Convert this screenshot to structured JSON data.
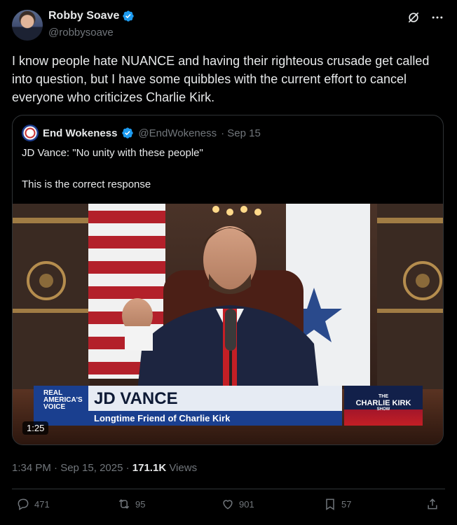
{
  "author": {
    "name": "Robby Soave",
    "handle": "@robbysoave"
  },
  "tweet": {
    "text": "I know people hate NUANCE and having their righteous crusade get called into question, but I have some quibbles with the current effort to cancel everyone who criticizes Charlie Kirk."
  },
  "quote": {
    "name": "End Wokeness",
    "handle": "@EndWokeness",
    "date": "· Sep 15",
    "line1": "JD Vance: \"No unity with these people\"",
    "line2": "This is the correct response",
    "video": {
      "duration": "1:25",
      "lower_third": {
        "network_line1": "REAL",
        "network_line2": "AMERICA'S",
        "network_line3": "VOICE",
        "name": "JD VANCE",
        "subtitle": "Longtime Friend of Charlie Kirk",
        "show_small": "THE",
        "show_name": "CHARLIE KIRK",
        "show_suffix": "SHOW"
      }
    }
  },
  "meta": {
    "time": "1:34 PM · Sep 15, 2025 · ",
    "views_count": "171.1K",
    "views_label": " Views"
  },
  "actions": {
    "replies": "471",
    "reposts": "95",
    "likes": "901",
    "bookmarks": "57"
  },
  "colors": {
    "background": "#000000",
    "text": "#e7e9ea",
    "muted": "#71767b",
    "verified": "#1d9bf0",
    "border": "#2f3336"
  }
}
